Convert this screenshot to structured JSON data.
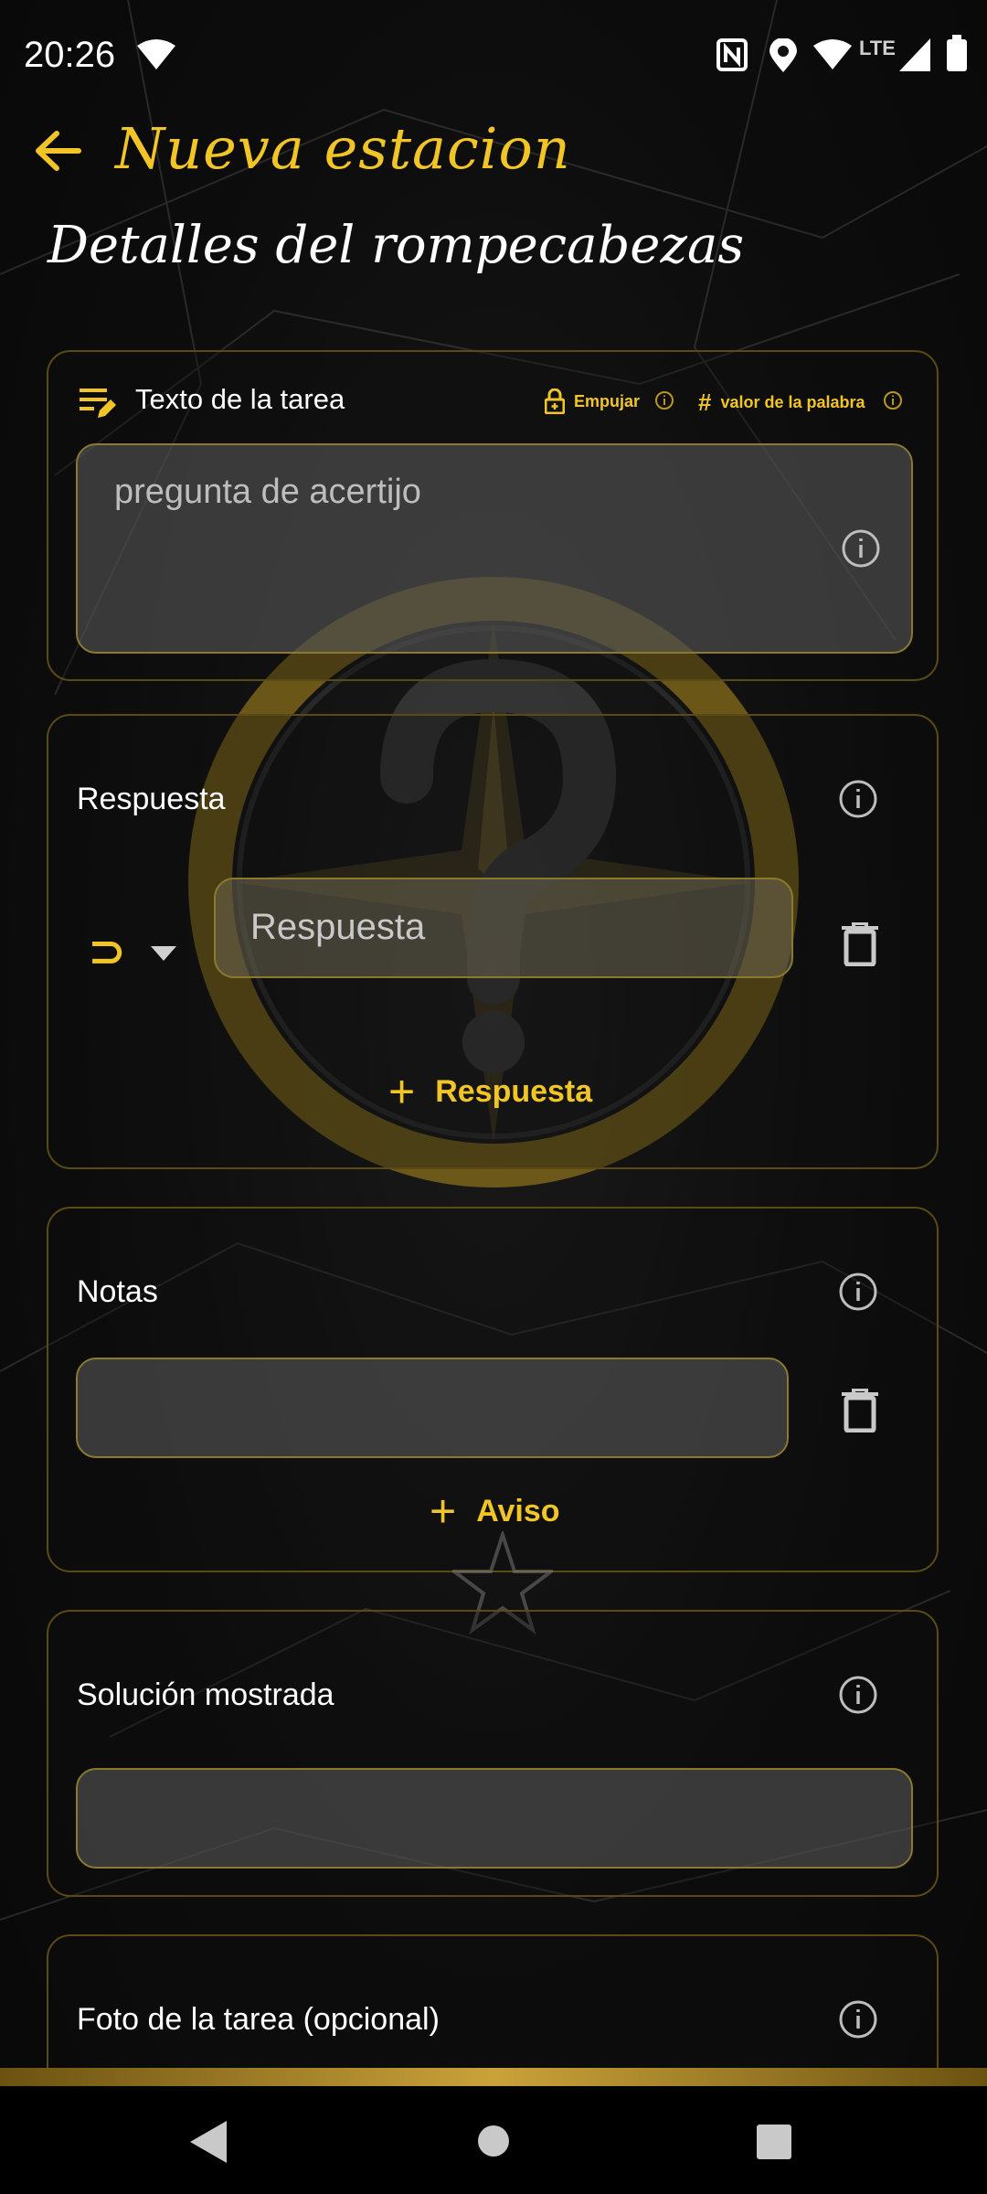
{
  "status_bar": {
    "time": "20:26",
    "network": "LTE",
    "icons": [
      "wifi-icon",
      "nfc-icon",
      "location-icon",
      "wifi-icon",
      "signal-icon",
      "battery-icon"
    ]
  },
  "header": {
    "title": "Nueva estacion",
    "back_icon": "arrow-back-icon"
  },
  "section_title": "Detalles del rompecabezas",
  "task_text": {
    "label": "Texto de la tarea",
    "push_label": "Empujar",
    "word_value_label": "valor de la palabra",
    "placeholder": "pregunta de acertijo"
  },
  "answer": {
    "label": "Respuesta",
    "operator_symbol": "⊃",
    "placeholder": "Respuesta",
    "add_label": "Respuesta"
  },
  "notes": {
    "label": "Notas",
    "add_label": "Aviso"
  },
  "solution": {
    "label": "Solución mostrada"
  },
  "photo": {
    "label": "Foto de la tarea (opcional)"
  },
  "colors": {
    "accent": "#f2c526",
    "card_border": "#5a4a15",
    "field_bg": "#5f5f5f",
    "background": "#0f0f0f"
  }
}
